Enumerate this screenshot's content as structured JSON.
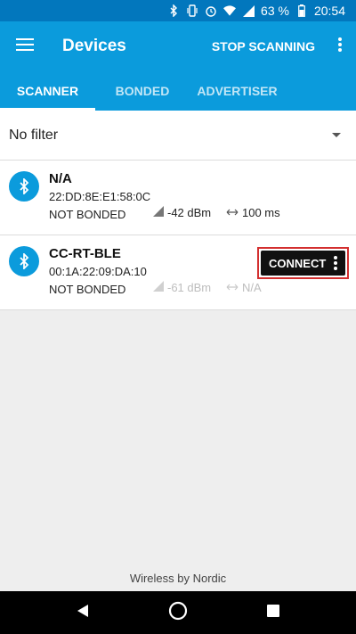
{
  "status_bar": {
    "battery": "63 %",
    "time": "20:54",
    "icons": [
      "bluetooth-icon",
      "vibrate-icon",
      "alarm-icon",
      "wifi-icon",
      "signal-icon",
      "battery-icon"
    ]
  },
  "app_bar": {
    "title": "Devices",
    "stop_scanning": "STOP SCANNING",
    "menu_icon": "menu-icon",
    "overflow_icon": "more-vert-icon"
  },
  "tabs": [
    {
      "label": "SCANNER",
      "active": true
    },
    {
      "label": "BONDED",
      "active": false
    },
    {
      "label": "ADVERTISER",
      "active": false
    }
  ],
  "filter": {
    "label": "No filter"
  },
  "devices": [
    {
      "name": "N/A",
      "address": "22:DD:8E:E1:58:0C",
      "bond_state": "NOT BONDED",
      "rssi": "-42 dBm",
      "interval": "100 ms",
      "active": true
    },
    {
      "name": "CC-RT-BLE",
      "address": "00:1A:22:09:DA:10",
      "bond_state": "NOT BONDED",
      "rssi": "-61 dBm",
      "interval": "N/A",
      "active": false,
      "connect_label": "CONNECT"
    }
  ],
  "footer": "Wireless by Nordic",
  "colors": {
    "status_bar": "#0277bd",
    "primary": "#0b9bdc",
    "highlight_border": "#d32f2f"
  }
}
